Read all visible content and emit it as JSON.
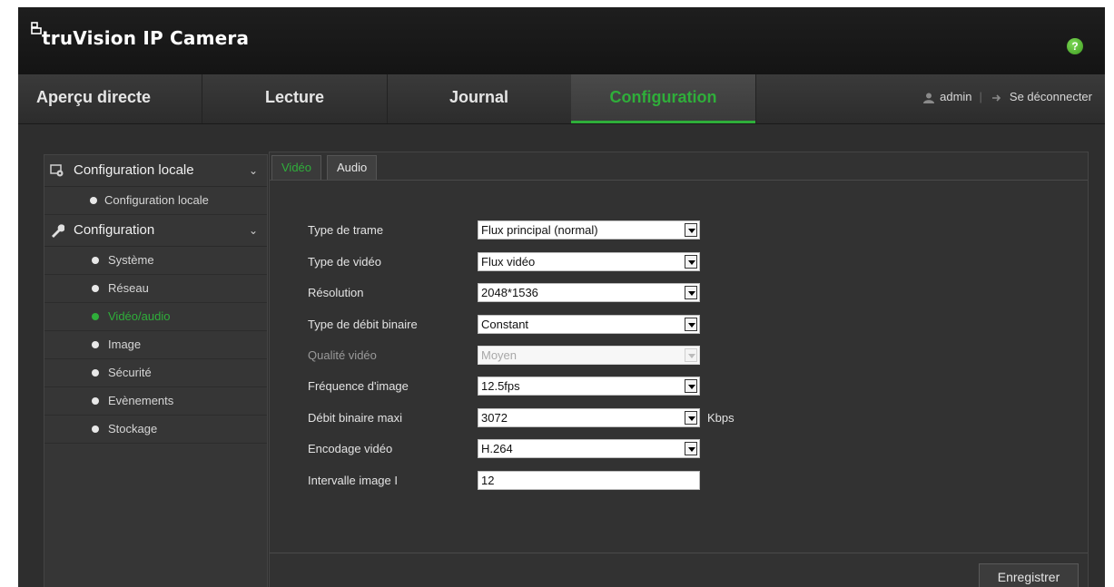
{
  "app": {
    "brand": "truVision IP Camera",
    "help_label": "?"
  },
  "nav": {
    "tabs": [
      {
        "label": "Aperçu directe"
      },
      {
        "label": "Lecture"
      },
      {
        "label": "Journal"
      },
      {
        "label": "Configuration",
        "active": true
      }
    ],
    "user": "admin",
    "logout": "Se déconnecter"
  },
  "sidebar": {
    "local_section": "Configuration locale",
    "local_item": "Configuration locale",
    "config_section": "Configuration",
    "items": [
      {
        "label": "Système"
      },
      {
        "label": "Réseau"
      },
      {
        "label": "Vidéo/audio",
        "active": true
      },
      {
        "label": "Image"
      },
      {
        "label": "Sécurité"
      },
      {
        "label": "Evènements"
      },
      {
        "label": "Stockage"
      }
    ]
  },
  "tabs": {
    "video": "Vidéo",
    "audio": "Audio"
  },
  "form": {
    "stream_type": {
      "label": "Type de trame",
      "value": "Flux principal (normal)"
    },
    "video_type": {
      "label": "Type de vidéo",
      "value": "Flux vidéo"
    },
    "resolution": {
      "label": "Résolution",
      "value": "2048*1536"
    },
    "bitrate_type": {
      "label": "Type de débit binaire",
      "value": "Constant"
    },
    "video_quality": {
      "label": "Qualité vidéo",
      "value": "Moyen",
      "disabled": true
    },
    "frame_rate": {
      "label": "Fréquence d'image",
      "value": "12.5fps"
    },
    "max_bitrate": {
      "label": "Débit binaire maxi",
      "value": "3072",
      "unit": "Kbps"
    },
    "encoding": {
      "label": "Encodage vidéo",
      "value": "H.264"
    },
    "i_frame_interval": {
      "label": "Intervalle image I",
      "value": "12"
    }
  },
  "save_label": "Enregistrer",
  "colors": {
    "accent": "#2fae3a",
    "background": "#2b2b2b"
  }
}
